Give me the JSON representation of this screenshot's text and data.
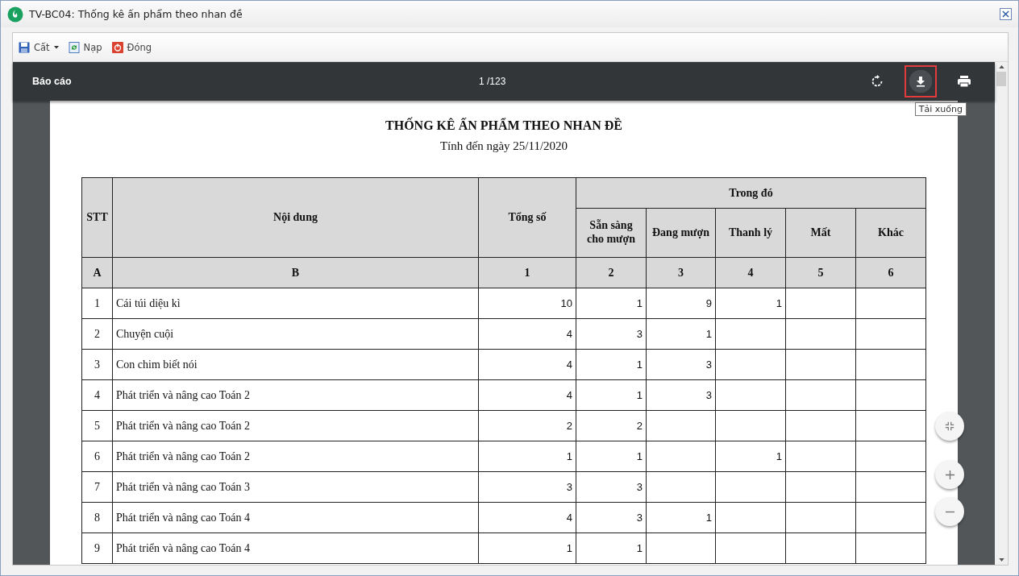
{
  "window": {
    "title": "TV-BC04: Thống kê ấn phẩm theo nhan đề"
  },
  "toolbar": [
    {
      "kind": "save",
      "label": "Cất",
      "dropdown": true
    },
    {
      "kind": "reload",
      "label": "Nạp",
      "dropdown": false
    },
    {
      "kind": "close",
      "label": "Đóng",
      "dropdown": false
    }
  ],
  "viewer": {
    "title": "Báo cáo",
    "page": "1 /123",
    "actions": [
      {
        "kind": "rotate",
        "highlighted": false
      },
      {
        "kind": "download",
        "highlighted": true,
        "tooltip": "Tải xuống"
      },
      {
        "kind": "print",
        "highlighted": false
      }
    ]
  },
  "report": {
    "title": "THỐNG KÊ ẤN PHẨM THEO NHAN ĐỀ",
    "subtitle": "Tính đến ngày 25/11/2020",
    "group_header": "Trong đó",
    "columns": [
      "STT",
      "Nội dung",
      "Tổng số",
      "Sẵn sàng cho mượn",
      "Đang mượn",
      "Thanh lý",
      "Mất",
      "Khác"
    ],
    "column_codes": [
      "A",
      "B",
      "1",
      "2",
      "3",
      "4",
      "5",
      "6"
    ],
    "rows": [
      [
        "1",
        "Cái túi diệu kì",
        "10",
        "1",
        "9",
        "1",
        "",
        ""
      ],
      [
        "2",
        "Chuyện cuội",
        "4",
        "3",
        "1",
        "",
        "",
        ""
      ],
      [
        "3",
        "Con chim biết nói",
        "4",
        "1",
        "3",
        "",
        "",
        ""
      ],
      [
        "4",
        "Phát triển và nâng cao Toán 2",
        "4",
        "1",
        "3",
        "",
        "",
        ""
      ],
      [
        "5",
        "Phát triển và nâng cao Toán 2",
        "2",
        "2",
        "",
        "",
        "",
        ""
      ],
      [
        "6",
        "Phát triển và nâng cao Toán 2",
        "1",
        "1",
        "",
        "1",
        "",
        ""
      ],
      [
        "7",
        "Phát triển và nâng cao Toán 3",
        "3",
        "3",
        "",
        "",
        "",
        ""
      ],
      [
        "8",
        "Phát triển và nâng cao Toán 4",
        "4",
        "3",
        "1",
        "",
        "",
        ""
      ],
      [
        "9",
        "Phát triển và nâng cao Toán 4",
        "1",
        "1",
        "",
        "",
        "",
        ""
      ]
    ]
  },
  "zoom_controls": [
    {
      "kind": "fit"
    },
    {
      "kind": "zoom_in"
    },
    {
      "kind": "zoom_out"
    }
  ]
}
